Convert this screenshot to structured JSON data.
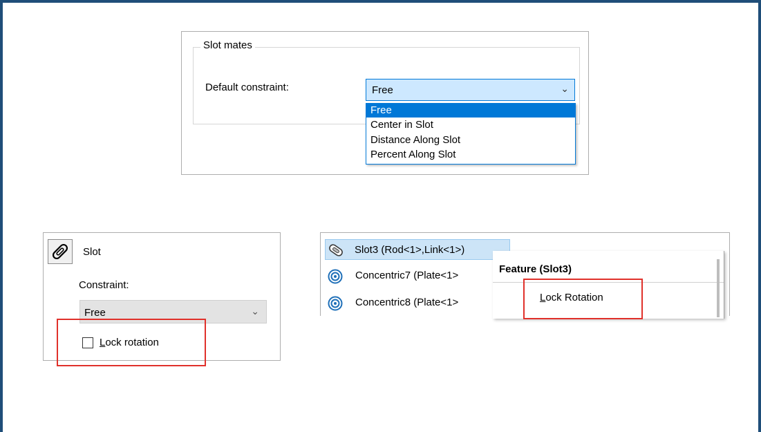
{
  "colors": {
    "frame_border": "#1f4e79",
    "selection_blue": "#0078d7",
    "select_bg": "#cde8ff",
    "tree_selection": "#cce4f7",
    "highlight_red": "#e0302a"
  },
  "slot_mates": {
    "group_title": "Slot mates",
    "default_constraint_label": "Default constraint:",
    "selected_value": "Free",
    "options": [
      "Free",
      "Center in Slot",
      "Distance Along Slot",
      "Percent Along Slot"
    ],
    "dropdown_icon": "chevron-down-icon"
  },
  "slot_panel": {
    "icon": "slot-mate-icon",
    "title": "Slot",
    "constraint_label": "Constraint:",
    "constraint_value": "Free",
    "lock_rotation_prefix": "",
    "lock_rotation_mnemonic": "L",
    "lock_rotation_rest": "ock rotation",
    "lock_rotation_checked": false
  },
  "feature_tree": {
    "rows": [
      {
        "icon": "slot-mate-icon",
        "label": "Slot3 (Rod<1>,Link<1>)"
      },
      {
        "icon": "concentric-icon",
        "label": "Concentric7 (Plate<1>"
      },
      {
        "icon": "concentric-icon",
        "label": "Concentric8 (Plate<1>"
      }
    ]
  },
  "context_menu": {
    "title": "Feature (Slot3)",
    "item_mnemonic": "L",
    "item_rest": "ock Rotation"
  }
}
